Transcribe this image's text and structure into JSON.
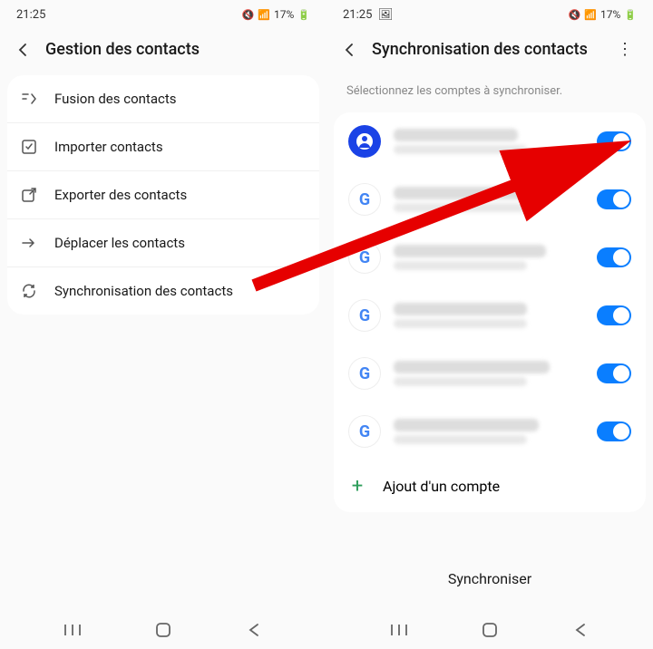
{
  "status": {
    "time": "21:25",
    "battery": "17%"
  },
  "left": {
    "title": "Gestion des contacts",
    "items": [
      {
        "label": "Fusion des contacts"
      },
      {
        "label": "Importer contacts"
      },
      {
        "label": "Exporter des contacts"
      },
      {
        "label": "Déplacer les contacts"
      },
      {
        "label": "Synchronisation des contacts"
      }
    ]
  },
  "right": {
    "title": "Synchronisation des contacts",
    "subtitle": "Sélectionnez les comptes à synchroniser.",
    "add_label": "Ajout d'un compte",
    "sync_label": "Synchroniser"
  }
}
